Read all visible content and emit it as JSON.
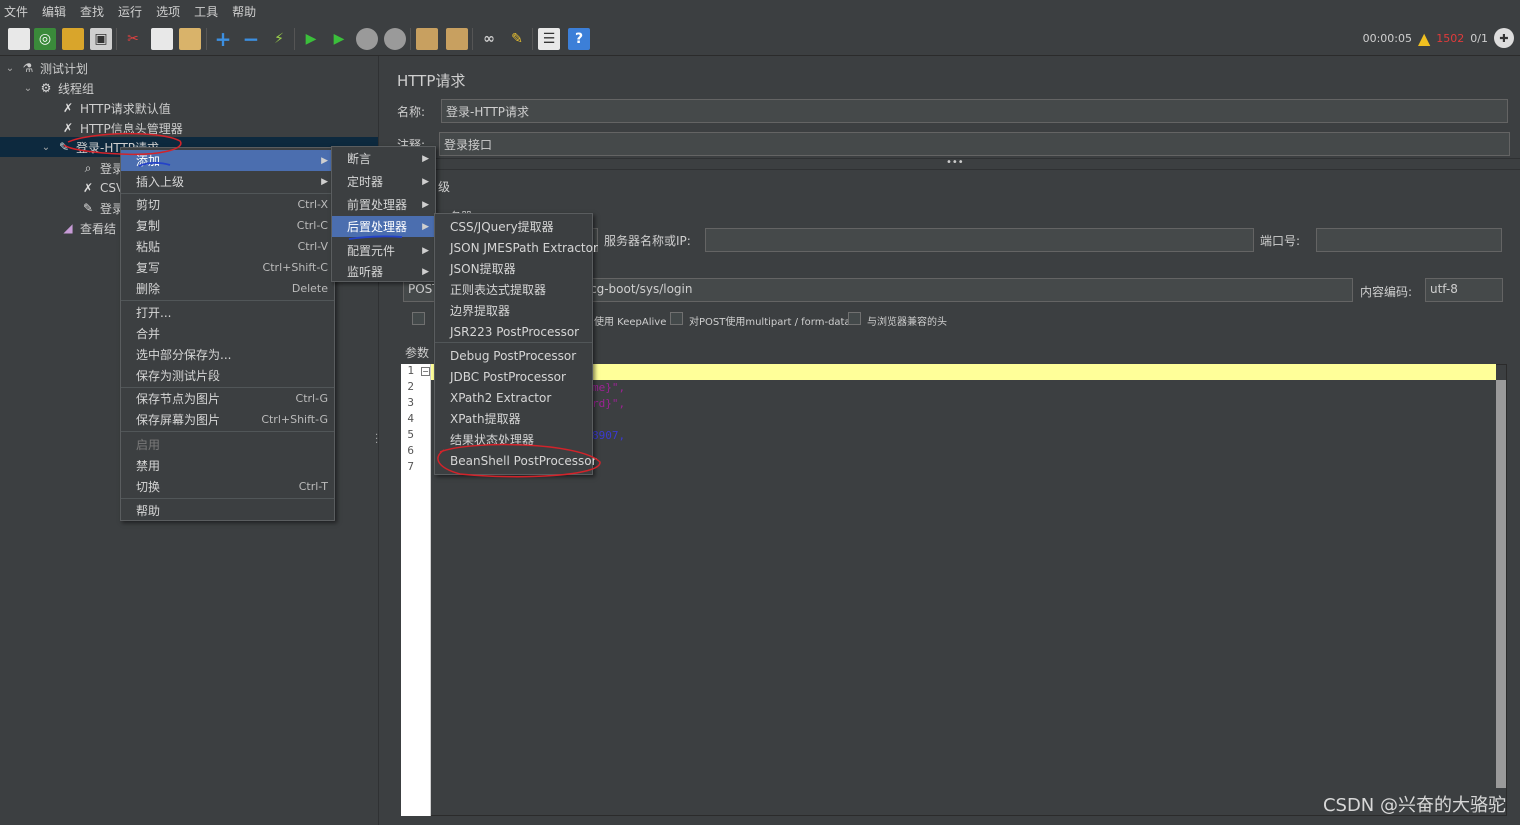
{
  "menubar": [
    "文件",
    "编辑",
    "查找",
    "运行",
    "选项",
    "工具",
    "帮助"
  ],
  "toolbar_icons": [
    "new-icon",
    "templates-icon",
    "open-icon",
    "save-icon",
    "cut-icon",
    "copy-icon",
    "paste-icon",
    "expand-icon",
    "collapse-icon",
    "toggle-icon",
    "start-icon",
    "start-no-pause-icon",
    "stop-icon",
    "shutdown-icon",
    "clear-icon",
    "clear-all-icon",
    "search-icon",
    "reset-search-icon",
    "function-helper-icon",
    "help-icon"
  ],
  "status": {
    "elapsed": "00:00:05",
    "error_count": "1502",
    "threads": "0/1"
  },
  "tree": {
    "test_plan": "测试计划",
    "thread_group": "线程组",
    "defaults": "HTTP请求默认值",
    "header_mgr": "HTTP信息头管理器",
    "selected": "登录-HTTP请求",
    "child1": "登录",
    "child2": "CSV",
    "child3": "登录",
    "results": "查看结"
  },
  "panel": {
    "title": "HTTP请求",
    "name_label": "名称:",
    "name_value": "登录-HTTP请求",
    "comment_label": "注释:",
    "comment_value": "登录接口",
    "partial_1": "级",
    "partial_2": "务器",
    "server_label": "服务器名称或IP:",
    "server_value": "",
    "port_label": "端口号:",
    "port_value": "",
    "method": "POST",
    "path": "cg-boot/sys/login",
    "encoding_label": "内容编码:",
    "encoding_value": "utf-8",
    "keepalive": "使用 KeepAlive",
    "multipart": "对POST使用multipart / form-data",
    "browser_headers": "与浏览器兼容的头",
    "params_tab": "参数",
    "code_line2": "me}\",",
    "code_line3": "rd}\",",
    "code_line5": "8907,"
  },
  "gutter": [
    "1",
    "2",
    "3",
    "4",
    "5",
    "6",
    "7"
  ],
  "context_menu": {
    "add": "添加",
    "insert_parent": "插入上级",
    "cut": "剪切",
    "cut_sc": "Ctrl-X",
    "copy": "复制",
    "copy_sc": "Ctrl-C",
    "paste": "粘贴",
    "paste_sc": "Ctrl-V",
    "duplicate": "复写",
    "duplicate_sc": "Ctrl+Shift-C",
    "delete": "删除",
    "delete_sc": "Delete",
    "open": "打开...",
    "merge": "合并",
    "save_selection": "选中部分保存为...",
    "save_fragment": "保存为测试片段",
    "save_node_image": "保存节点为图片",
    "save_node_image_sc": "Ctrl-G",
    "save_screen_image": "保存屏幕为图片",
    "save_screen_image_sc": "Ctrl+Shift-G",
    "enable": "启用",
    "disable": "禁用",
    "toggle": "切换",
    "toggle_sc": "Ctrl-T",
    "help": "帮助"
  },
  "add_menu": {
    "assertion": "断言",
    "timer": "定时器",
    "pre_processor": "前置处理器",
    "post_processor": "后置处理器",
    "config": "配置元件",
    "listener": "监听器"
  },
  "post_menu": {
    "items": [
      "CSS/JQuery提取器",
      "JSON JMESPath Extractor",
      "JSON提取器",
      "正则表达式提取器",
      "边界提取器",
      "JSR223 PostProcessor",
      "Debug PostProcessor",
      "JDBC PostProcessor",
      "XPath2 Extractor",
      "XPath提取器",
      "结果状态处理器",
      "BeanShell PostProcessor"
    ]
  },
  "watermark": "CSDN @兴奋的大骆驼",
  "colors": {
    "background": "#3c3f41",
    "highlight": "#4b6eaf",
    "annotation_red": "#d2232a",
    "annotation_blue": "#2442c8"
  }
}
